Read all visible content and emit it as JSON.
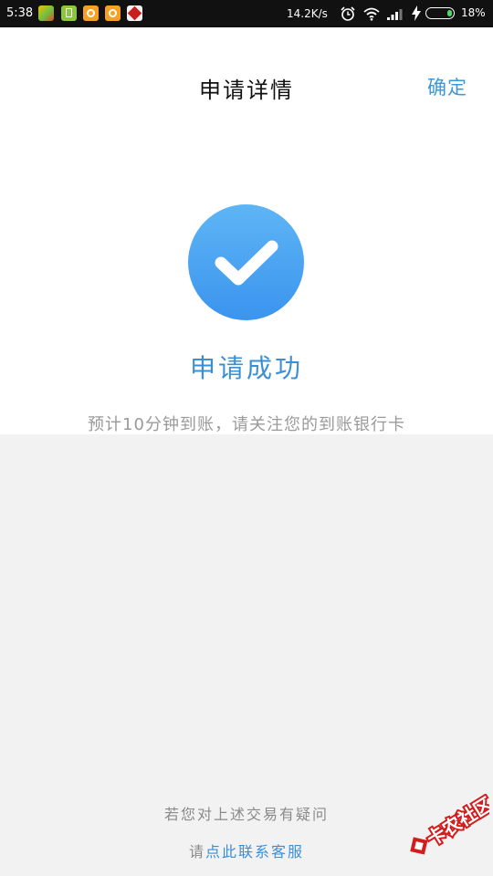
{
  "status_bar": {
    "time": "5:38",
    "network_speed": "14.2K/s",
    "battery_percent": "18%",
    "battery_level": 0.18,
    "app_icons": [
      "game-app-icon",
      "notes-app-icon",
      "camera-app-icon",
      "camera-app-icon",
      "kanong-app-icon"
    ],
    "system_icons": [
      "alarm-clock-icon",
      "wifi-icon",
      "signal-icon",
      "charging-bolt-icon",
      "battery-icon"
    ],
    "colors": {
      "background": "#111111",
      "battery_fill": "#4cd964"
    }
  },
  "header": {
    "title": "申请详情",
    "confirm_label": "确定"
  },
  "result": {
    "icon": "checkmark-icon",
    "title": "申请成功",
    "description": "预计10分钟到账，请关注您的到账银行卡"
  },
  "footer": {
    "question": "若您对上述交易有疑问",
    "contact_prefix": "请",
    "contact_link": "点此联系客服"
  },
  "watermark": {
    "text": "卡农社区",
    "icon": "kanong-logo-icon"
  },
  "colors": {
    "accent": "#3b8fd4",
    "success_circle": "#4aa3f0",
    "page_background": "#f2f2f2",
    "card_background": "#ffffff"
  }
}
